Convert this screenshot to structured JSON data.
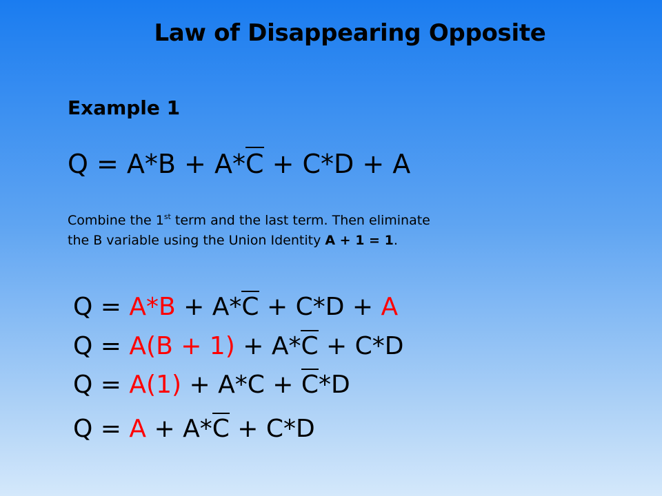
{
  "slide": {
    "title": "Law of Disappearing Opposite",
    "example_label": "Example 1",
    "equation": [
      {
        "t": "Q = A*B + A*"
      },
      {
        "t": "C",
        "ov": true
      },
      {
        "t": " + C*D + A"
      }
    ],
    "description": {
      "line1_a": "Combine the 1",
      "line1_sup": "st",
      "line1_b": " term and the last term. Then eliminate",
      "line2_a": "the B variable using the Union Identity ",
      "line2_bold": "A + 1 = 1",
      "line2_end": "."
    },
    "steps": [
      [
        {
          "t": "Q = "
        },
        {
          "t": "A*B",
          "red": true
        },
        {
          "t": " + A*"
        },
        {
          "t": "C",
          "ov": true
        },
        {
          "t": " + C*D + "
        },
        {
          "t": "A",
          "red": true
        }
      ],
      [
        {
          "t": "Q = "
        },
        {
          "t": "A(B + 1)",
          "red": true
        },
        {
          "t": " + A*"
        },
        {
          "t": "C",
          "ov": true
        },
        {
          "t": " + C*D"
        }
      ],
      [
        {
          "t": "Q = "
        },
        {
          "t": "A(1)",
          "red": true
        },
        {
          "t": " + A*C + "
        },
        {
          "t": "C",
          "ov": true
        },
        {
          "t": "*D"
        }
      ],
      [
        {
          "t": "Q = "
        },
        {
          "t": "A",
          "red": true
        },
        {
          "t": " + A*"
        },
        {
          "t": "C",
          "ov": true
        },
        {
          "t": " + C*D"
        }
      ]
    ],
    "colors": {
      "highlight": "#ff0000",
      "background_top": "#1a7cf0",
      "background_bottom": "#d4e8fb"
    }
  }
}
